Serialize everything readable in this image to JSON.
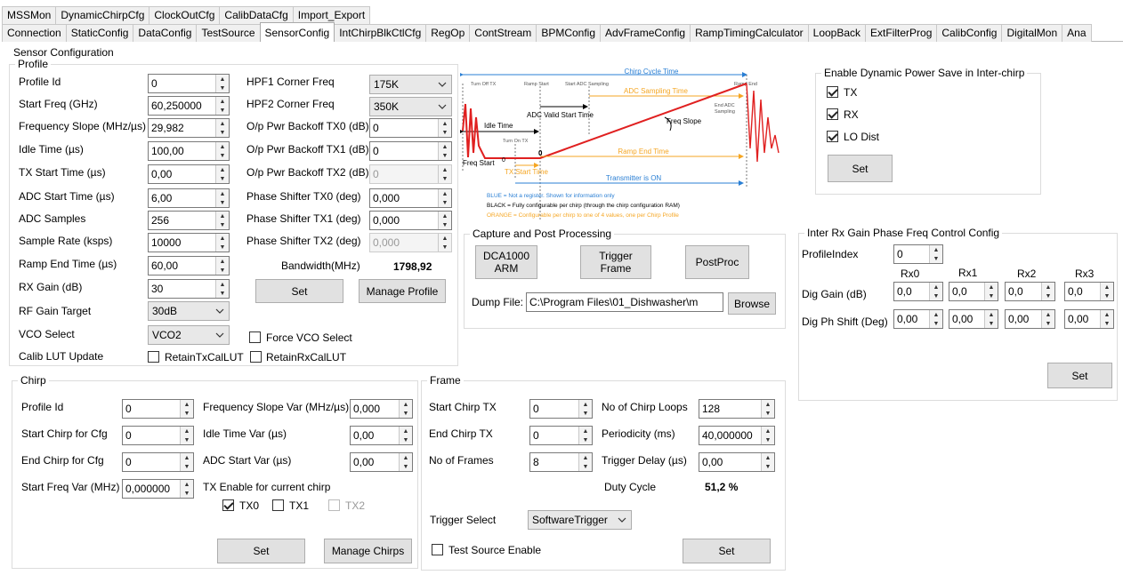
{
  "tabs_top": [
    "MSSMon",
    "DynamicChirpCfg",
    "ClockOutCfg",
    "CalibDataCfg",
    "Import_Export"
  ],
  "tabs_main": [
    "Connection",
    "StaticConfig",
    "DataConfig",
    "TestSource",
    "SensorConfig",
    "IntChirpBlkCtlCfg",
    "RegOp",
    "ContStream",
    "BPMConfig",
    "AdvFrameConfig",
    "RampTimingCalculator",
    "LoopBack",
    "ExtFilterProg",
    "CalibConfig",
    "DigitalMon",
    "Ana"
  ],
  "sensor_config_title": "Sensor Configuration",
  "profile": {
    "title": "Profile",
    "profile_id_label": "Profile Id",
    "profile_id": "0",
    "start_freq_label": "Start Freq (GHz)",
    "start_freq": "60,250000",
    "freq_slope_label": "Frequency Slope (MHz/µs)",
    "freq_slope": "29,982",
    "idle_time_label": "Idle Time (µs)",
    "idle_time": "100,00",
    "tx_start_label": "TX Start Time (µs)",
    "tx_start": "0,00",
    "adc_start_label": "ADC Start Time (µs)",
    "adc_start": "6,00",
    "adc_samples_label": "ADC Samples",
    "adc_samples": "256",
    "sample_rate_label": "Sample Rate (ksps)",
    "sample_rate": "10000",
    "ramp_end_label": "Ramp End Time (µs)",
    "ramp_end": "60,00",
    "rx_gain_label": "RX Gain (dB)",
    "rx_gain": "30",
    "rf_gain_label": "RF Gain Target",
    "rf_gain": "30dB",
    "vco_label": "VCO Select",
    "vco": "VCO2",
    "calib_lut_label": "Calib LUT Update",
    "retain_tx_label": "RetainTxCalLUT",
    "retain_rx_label": "RetainRxCalLUT",
    "hpf1_label": "HPF1 Corner Freq",
    "hpf1": "175K",
    "hpf2_label": "HPF2 Corner Freq",
    "hpf2": "350K",
    "tx0_backoff_label": "O/p Pwr Backoff TX0 (dB)",
    "tx0_backoff": "0",
    "tx1_backoff_label": "O/p Pwr Backoff TX1 (dB)",
    "tx1_backoff": "0",
    "tx2_backoff_label": "O/p Pwr Backoff TX2 (dB)",
    "tx2_backoff": "0",
    "ps_tx0_label": "Phase Shifter TX0 (deg)",
    "ps_tx0": "0,000",
    "ps_tx1_label": "Phase Shifter TX1 (deg)",
    "ps_tx1": "0,000",
    "ps_tx2_label": "Phase Shifter TX2 (deg)",
    "ps_tx2": "0,000",
    "bandwidth_label": "Bandwidth(MHz)",
    "bandwidth": "1798,92",
    "set_label": "Set",
    "manage_label": "Manage Profile",
    "force_vco_label": "Force VCO Select"
  },
  "diagram": {
    "chirp_cycle": "Chirp Cycle Time",
    "turn_off_tx": "Turn Off TX",
    "ramp_start": "Ramp Start",
    "start_adc": "Start ADC Sampling",
    "ramp_end": "Ramp End",
    "adc_sampling_time": "ADC Sampling Time",
    "end_adc": "End ADC",
    "sampling": "Sampling",
    "adc_valid": "ADC Valid Start Time",
    "freq_slope": "Freq Slope",
    "idle_time": "Idle Time",
    "turn_on_tx": "Turn On TX",
    "zero1": "0",
    "zero2": "0",
    "freq_start": "Freq Start",
    "tx_start_time": "TX Start Time",
    "ramp_end_time": "Ramp End Time",
    "tx_on": "Transmitter is ON",
    "legend_blue": "BLUE = Not a register. Shown for information only",
    "legend_black": "BLACK = Fully configurable per chirp (through the chirp configuration RAM)",
    "legend_orange": "ORANGE = Configurable per chirp to one of 4 values, one per Chirp Profile",
    "colors": {
      "blue": "#2a7fd4",
      "orange": "#f5a623",
      "red": "#e02020"
    }
  },
  "power_save": {
    "title": "Enable Dynamic Power Save in Inter-chirp",
    "tx": "TX",
    "rx": "RX",
    "lo": "LO Dist",
    "set": "Set"
  },
  "capture": {
    "title": "Capture and Post Processing",
    "dca": "DCA1000 ARM",
    "trigger": "Trigger Frame",
    "postproc": "PostProc",
    "dump_label": "Dump File:",
    "dump_value": "C:\\Program Files\\01_Dishwasher\\m",
    "browse": "Browse"
  },
  "interrx": {
    "title": "Inter Rx Gain Phase Freq Control Config",
    "profile_index_label": "ProfileIndex",
    "profile_index": "0",
    "cols": [
      "Rx0",
      "Rx1",
      "Rx2",
      "Rx3"
    ],
    "dig_gain_label": "Dig Gain (dB)",
    "dig_gain": [
      "0,0",
      "0,0",
      "0,0",
      "0,0"
    ],
    "dig_ph_label": "Dig Ph Shift (Deg)",
    "dig_ph": [
      "0,00",
      "0,00",
      "0,00",
      "0,00"
    ],
    "set": "Set"
  },
  "chirp": {
    "title": "Chirp",
    "profile_id_label": "Profile Id",
    "profile_id": "0",
    "start_chirp_label": "Start Chirp for Cfg",
    "start_chirp": "0",
    "end_chirp_label": "End Chirp for Cfg",
    "end_chirp": "0",
    "start_freq_var_label": "Start Freq Var (MHz)",
    "start_freq_var": "0,000000",
    "slope_var_label": "Frequency Slope Var (MHz/µs)",
    "slope_var": "0,000",
    "idle_var_label": "Idle Time Var (µs)",
    "idle_var": "0,00",
    "adc_var_label": "ADC Start Var (µs)",
    "adc_var": "0,00",
    "tx_enable_label": "TX Enable for current chirp",
    "tx0": "TX0",
    "tx1": "TX1",
    "tx2": "TX2",
    "set": "Set",
    "manage": "Manage Chirps"
  },
  "frame": {
    "title": "Frame",
    "start_tx_label": "Start Chirp TX",
    "start_tx": "0",
    "end_tx_label": "End Chirp TX",
    "end_tx": "0",
    "num_frames_label": "No of Frames",
    "num_frames": "8",
    "loops_label": "No of Chirp Loops",
    "loops": "128",
    "period_label": "Periodicity (ms)",
    "period": "40,000000",
    "delay_label": "Trigger Delay (µs)",
    "delay": "0,00",
    "duty_label": "Duty Cycle",
    "duty": "51,2 %",
    "trigger_sel_label": "Trigger Select",
    "trigger_sel": "SoftwareTrigger",
    "test_src_label": "Test Source Enable",
    "set": "Set"
  }
}
